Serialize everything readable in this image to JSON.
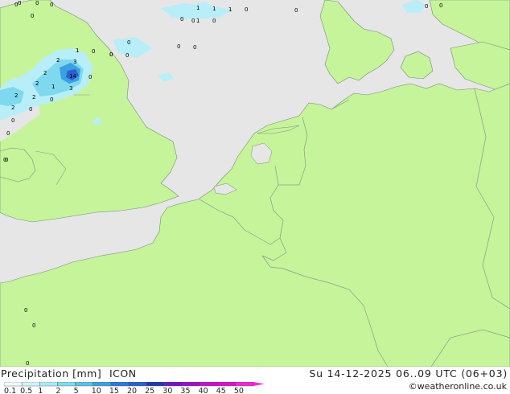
{
  "colors": {
    "sea": "#e6e6e6",
    "land": "#c6f49b",
    "border": "#8a9a8a",
    "coast": "#7a8a7a",
    "precip_light": "#b7eef8",
    "precip_mid": "#7fd9ee",
    "precip_heavy": "#3aa0e2",
    "precip_max": "#2b5fd0"
  },
  "footer": {
    "title": "Precipitation [mm]",
    "model": "ICON",
    "datetime": "Su 14-12-2025 06..09 UTC (06+03)",
    "credit": "©weatheronline.co.uk"
  },
  "legend": {
    "ticks": [
      "0.1",
      "0.5",
      "1",
      "2",
      "5",
      "10",
      "15",
      "20",
      "25",
      "30",
      "35",
      "40",
      "45",
      "50"
    ],
    "colors": [
      "#f0fcff",
      "#d0f4fb",
      "#a8e9f6",
      "#7fd9ee",
      "#55c3e6",
      "#3aa0e2",
      "#2b7ad8",
      "#2b5fd0",
      "#1f3aa8",
      "#6c18c8",
      "#9a10cc",
      "#c810cc",
      "#e010c8",
      "#ef2ad0"
    ]
  },
  "map_values": [
    {
      "id": "v1",
      "text": "0"
    },
    {
      "id": "v2",
      "text": "0"
    },
    {
      "id": "v3",
      "text": "0"
    },
    {
      "id": "v4",
      "text": "0"
    },
    {
      "id": "v5",
      "text": "1"
    },
    {
      "id": "v6",
      "text": "1"
    },
    {
      "id": "v7",
      "text": "1"
    },
    {
      "id": "v8",
      "text": "0"
    },
    {
      "id": "v9",
      "text": "0"
    },
    {
      "id": "v10",
      "text": "1"
    },
    {
      "id": "v11",
      "text": "0"
    },
    {
      "id": "v12",
      "text": "0"
    },
    {
      "id": "v13",
      "text": "0"
    },
    {
      "id": "v14",
      "text": "0"
    },
    {
      "id": "v15",
      "text": "0"
    },
    {
      "id": "v16",
      "text": "0"
    },
    {
      "id": "v17",
      "text": "1"
    },
    {
      "id": "v18",
      "text": "0"
    },
    {
      "id": "v19",
      "text": "2"
    },
    {
      "id": "v20",
      "text": "3"
    },
    {
      "id": "v21",
      "text": "2"
    },
    {
      "id": "v22",
      "text": "14"
    },
    {
      "id": "v23",
      "text": "0"
    },
    {
      "id": "v24",
      "text": "0"
    },
    {
      "id": "v25",
      "text": "0"
    },
    {
      "id": "v26",
      "text": "2"
    },
    {
      "id": "v27",
      "text": "1"
    },
    {
      "id": "v28",
      "text": "3"
    },
    {
      "id": "v29",
      "text": "2"
    },
    {
      "id": "v30",
      "text": "2"
    },
    {
      "id": "v31",
      "text": "0"
    },
    {
      "id": "v32",
      "text": "2"
    },
    {
      "id": "v33",
      "text": "0"
    },
    {
      "id": "v34",
      "text": "0"
    },
    {
      "id": "v35",
      "text": "0"
    },
    {
      "id": "v36",
      "text": "0"
    },
    {
      "id": "v37",
      "text": "0"
    },
    {
      "id": "v38",
      "text": "0"
    },
    {
      "id": "v39",
      "text": "0"
    },
    {
      "id": "v40",
      "text": "0"
    },
    {
      "id": "v41",
      "text": "0"
    },
    {
      "id": "v42",
      "text": "0"
    },
    {
      "id": "v43",
      "text": "0"
    },
    {
      "id": "v44",
      "text": "0"
    }
  ]
}
